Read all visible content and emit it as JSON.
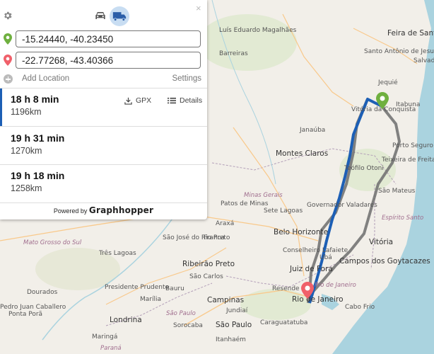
{
  "panel": {
    "start_value": "-15.24440, -40.23450",
    "end_value": "-22.77268, -43.40366",
    "add_location_label": "Add Location",
    "settings_label": "Settings",
    "close_glyph": "×",
    "powered_by": "Powered by",
    "logo_text": "Graphhopper",
    "modes": [
      "car-icon",
      "truck-icon"
    ],
    "selected_mode": "truck",
    "gpx_label": "GPX",
    "details_label": "Details"
  },
  "routes": [
    {
      "time": "18 h 8 min",
      "distance": "1196km",
      "selected": true
    },
    {
      "time": "19 h 31 min",
      "distance": "1270km",
      "selected": false
    },
    {
      "time": "19 h 18 min",
      "distance": "1258km",
      "selected": false
    }
  ],
  "colors": {
    "selected_route": "#1d5fb5",
    "alt_route": "#6d6d6d",
    "start_marker": "#6fb03f",
    "end_marker": "#f0606a",
    "land": "#f2efe9",
    "water": "#aad3df"
  },
  "map_labels": {
    "feira_de_santana": "Feira de Santana",
    "salvador": "Salvador",
    "santo_antonio_de_jesus": "Santo Antônio de Jesus",
    "luis_eduardo": "Luís Eduardo Magalhães",
    "barreiras": "Barreiras",
    "jequie": "Jequié",
    "vitoria_da_conquista": "Vitória da Conquista",
    "itabuna": "Itabuna",
    "porto_seguro": "Porto Seguro",
    "teixeira_de_freitas": "Teixeira de Freitas",
    "janauba": "Janaúba",
    "montes_claros": "Montes Claros",
    "teofilo_otoni": "Teófilo Otoni",
    "sao_mateus": "São Mateus",
    "minas_gerais": "Minas Gerais",
    "espirito_santo": "Espírito Santo",
    "patos_de_minas": "Patos de Minas",
    "sete_lagoas": "Sete Lagoas",
    "governador_valadares": "Governador Valadares",
    "belo_horizonte": "Belo Horizonte",
    "araxa": "Araxá",
    "mato_grosso_do_sul": "Mato Grosso do Sul",
    "sao_jose_rio_preto": "São José do Rio Preto",
    "franca": "Franca",
    "conselheiro_lafaiete": "Conselheiro Lafaiete",
    "ubá": "Ubá",
    "vitoria": "Vitória",
    "campos": "Campos dos Goytacazes",
    "tres_lagoas": "Três Lagoas",
    "ribeirao_preto": "Ribeirão Preto",
    "sao_carlos": "São Carlos",
    "juiz_de_fora": "Juiz de Fora",
    "rio_de_janeiro": "Rio de Janeiro",
    "rio_state": "Rio de Janeiro",
    "resende": "Resende",
    "cabo_frio": "Cabo Frio",
    "presidente_prudente": "Presidente Prudente",
    "dourados": "Dourados",
    "bauru": "Bauru",
    "marilia": "Marília",
    "campinas": "Campinas",
    "jundiai": "Jundiaí",
    "sao_paulo": "São Paulo",
    "sao_paulo_state": "São Paulo",
    "londrina": "Londrina",
    "maringa": "Maringá",
    "caraguatatuba": "Caraguatatuba",
    "itanhaem": "Itanhaém",
    "parana": "Paraná",
    "sorocaba": "Sorocaba",
    "ponta_pora": "Ponta Porã",
    "pedro_juan": "Pedro Juan Caballero"
  }
}
